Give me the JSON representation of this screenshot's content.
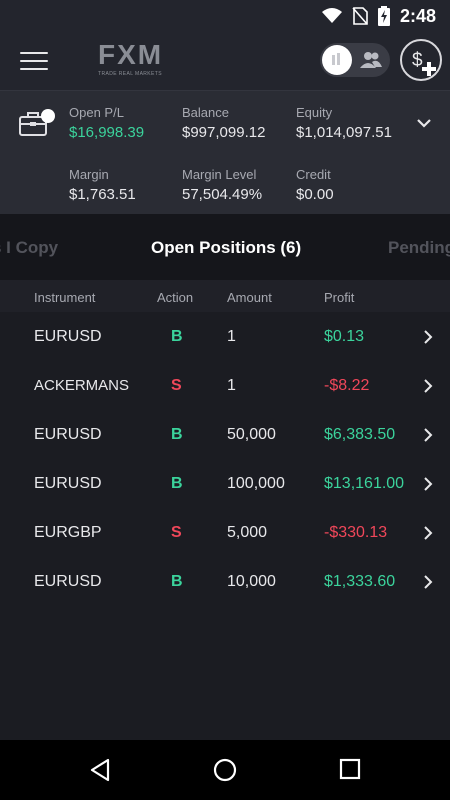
{
  "status_bar": {
    "time": "2:48",
    "icons": [
      "wifi-icon",
      "no-sim-icon",
      "battery-charging-icon"
    ]
  },
  "app_bar": {
    "menu_icon": "hamburger-menu-icon",
    "logo": {
      "name": "FXM",
      "tagline": "TRADE REAL MARKETS"
    },
    "toggle_icon": "people-icon",
    "deposit_icon": "dollar-plus-icon"
  },
  "account": {
    "metrics": [
      {
        "label": "Open P/L",
        "value": "$16,998.39",
        "color": "#3bd39c"
      },
      {
        "label": "Balance",
        "value": "$997,099.12"
      },
      {
        "label": "Equity",
        "value": "$1,014,097.51"
      },
      {
        "label": "Margin",
        "value": "$1,763.51"
      },
      {
        "label": "Margin Level",
        "value": "57,504.49%"
      },
      {
        "label": "Credit",
        "value": "$0.00"
      }
    ]
  },
  "tabs": [
    {
      "label": "s I Copy"
    },
    {
      "label": "Open Positions (6)",
      "active": true
    },
    {
      "label": "Pending"
    }
  ],
  "table": {
    "columns": [
      "Instrument",
      "Action",
      "Amount",
      "Profit"
    ],
    "rows": [
      {
        "instrument": "EURUSD",
        "action": "B",
        "amount": "1",
        "profit": "$0.13"
      },
      {
        "instrument": "ACKERMANS",
        "action": "S",
        "amount": "1",
        "profit": "-$8.22"
      },
      {
        "instrument": "EURUSD",
        "action": "B",
        "amount": "50,000",
        "profit": "$6,383.50"
      },
      {
        "instrument": "EURUSD",
        "action": "B",
        "amount": "100,000",
        "profit": "$13,161.00"
      },
      {
        "instrument": "EURGBP",
        "action": "S",
        "amount": "5,000",
        "profit": "-$330.13"
      },
      {
        "instrument": "EURUSD",
        "action": "B",
        "amount": "10,000",
        "profit": "$1,333.60"
      }
    ]
  },
  "colors": {
    "background": "#1b1c22",
    "buy": "#3bd39c",
    "sell": "#f0475a",
    "profit_positive": "#3bd39c",
    "profit_negative": "#f0475a"
  }
}
